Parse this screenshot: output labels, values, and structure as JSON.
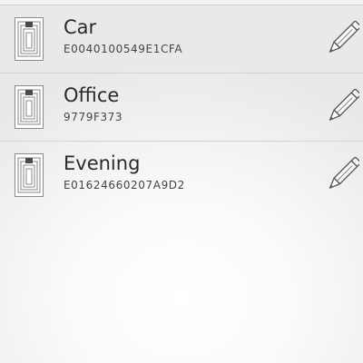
{
  "tags": [
    {
      "name": "Car",
      "id": "E0040100549E1CFA",
      "icon": "nfc-tag-icon",
      "action_icon": "pencil-icon"
    },
    {
      "name": "Office",
      "id": "9779F373",
      "icon": "nfc-tag-icon",
      "action_icon": "pencil-icon"
    },
    {
      "name": "Evening",
      "id": "E01624660207A9D2",
      "icon": "nfc-tag-icon",
      "action_icon": "pencil-icon"
    }
  ],
  "colors": {
    "text_primary": "#2a2a2a",
    "text_secondary": "#444444",
    "divider": "#d3d3d3"
  }
}
